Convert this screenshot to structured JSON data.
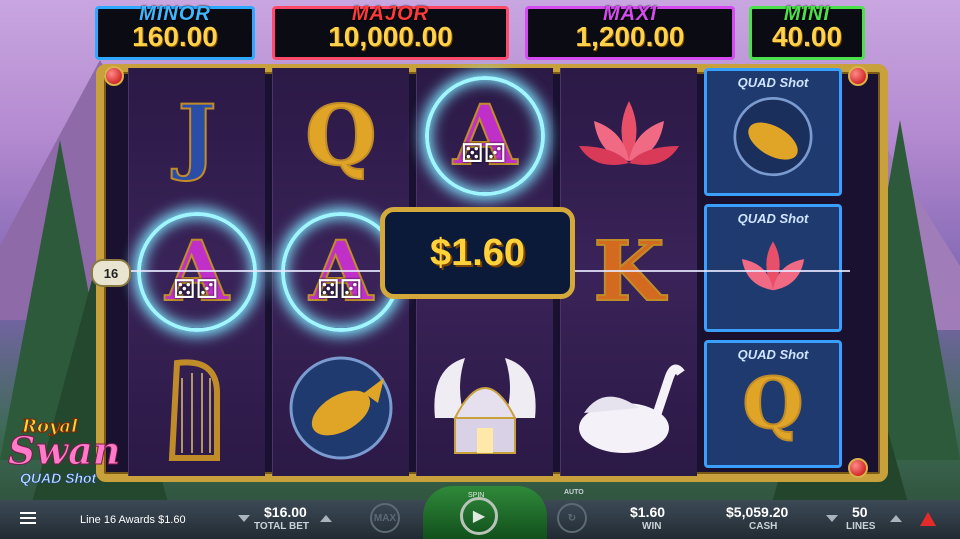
{
  "jackpots": {
    "minor": {
      "label": "MINOR",
      "value": "160.00"
    },
    "major": {
      "label": "MAJOR",
      "value": "10,000.00"
    },
    "maxi": {
      "label": "MAXI",
      "value": "1,200.00"
    },
    "mini": {
      "label": "MINI",
      "value": "40.00"
    }
  },
  "reels": {
    "r1": {
      "top": "J",
      "mid": "A",
      "bot": "harp"
    },
    "r2": {
      "top": "Q",
      "mid": "A",
      "bot": "koi"
    },
    "r3": {
      "top": "A",
      "bot": "palace"
    },
    "r4": {
      "top": "lotus",
      "mid": "K",
      "bot": "swan"
    },
    "r5": {
      "tag": "QUAD Shot",
      "top": "koi",
      "mid": "lotus",
      "bot": "Q"
    }
  },
  "win_line": {
    "number": "16"
  },
  "win_popup": {
    "amount": "$1.60"
  },
  "logo": {
    "royal": "Royal",
    "swan": "Swan",
    "quad": "QUAD Shot"
  },
  "bottom": {
    "status": "Line 16 Awards $1.60",
    "total_bet_value": "$16.00",
    "total_bet_label": "TOTAL BET",
    "max_label": "MAX",
    "spin_label": "SPIN",
    "auto_label": "AUTO",
    "win_value": "$1.60",
    "win_label": "WIN",
    "cash_value": "$5,059.20",
    "cash_label": "CASH",
    "lines_value": "50",
    "lines_label": "LINES"
  }
}
